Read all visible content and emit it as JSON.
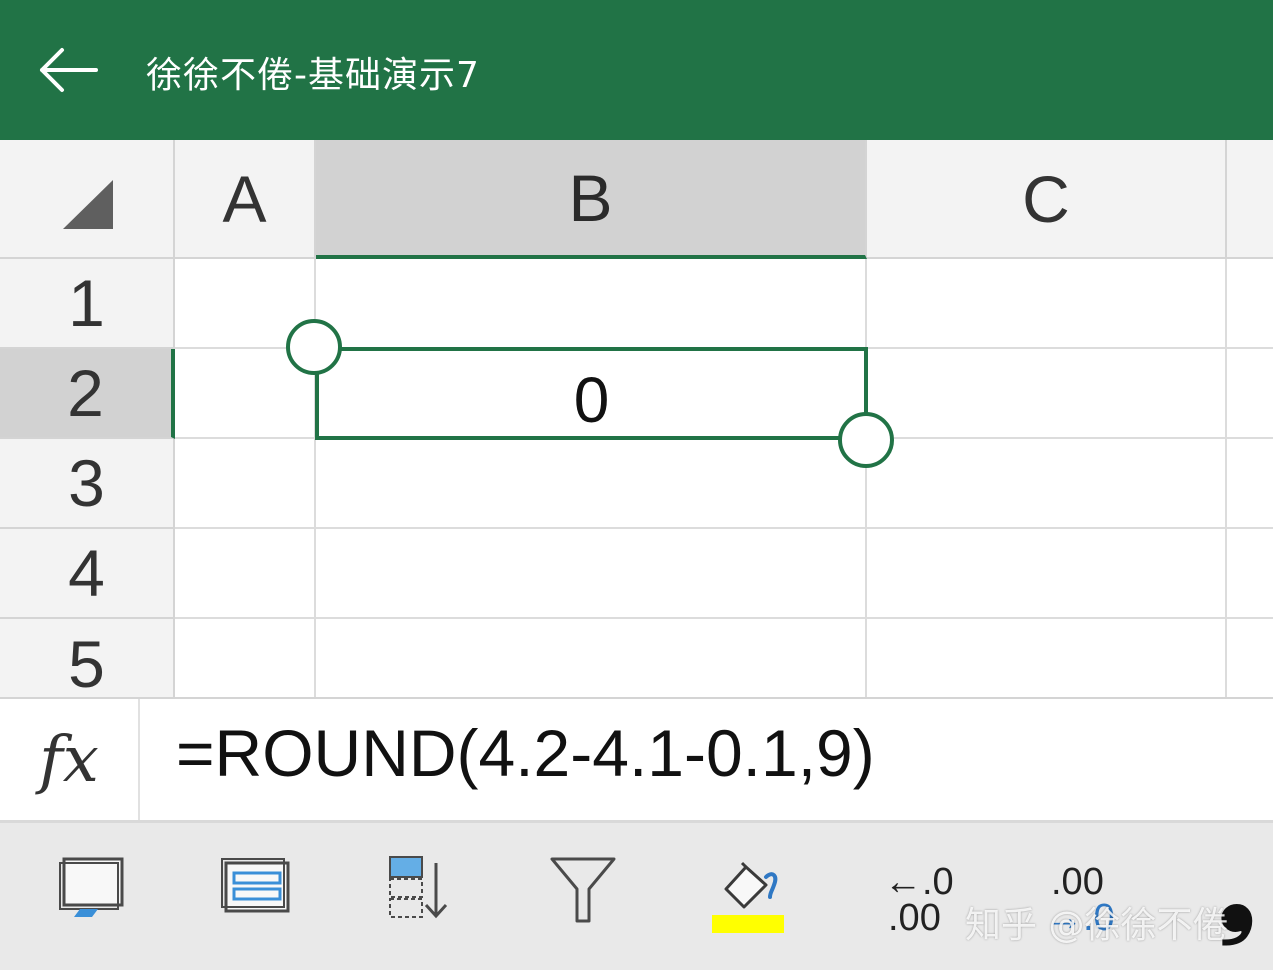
{
  "header": {
    "title": "徐徐不倦-基础演示7",
    "back_icon": "arrow-left-icon"
  },
  "grid": {
    "columns": [
      "A",
      "B",
      "C"
    ],
    "selected_column": "B",
    "rows": [
      "1",
      "2",
      "3",
      "4",
      "5"
    ],
    "selected_row": "2",
    "selected_cell_value": "0"
  },
  "formula_bar": {
    "label": "fx",
    "formula": "=ROUND(4.2-4.1-0.1,9)"
  },
  "toolbar": {
    "decrease_decimal_top": "←.0",
    "decrease_decimal_bottom": ".00",
    "increase_decimal_top": ".00",
    "increase_decimal_bottom": "→.0",
    "comma_style": "❟",
    "fill_color": "#FFFF00"
  },
  "watermark": "知乎 @徐徐不倦",
  "colors": {
    "brand": "#217346"
  }
}
